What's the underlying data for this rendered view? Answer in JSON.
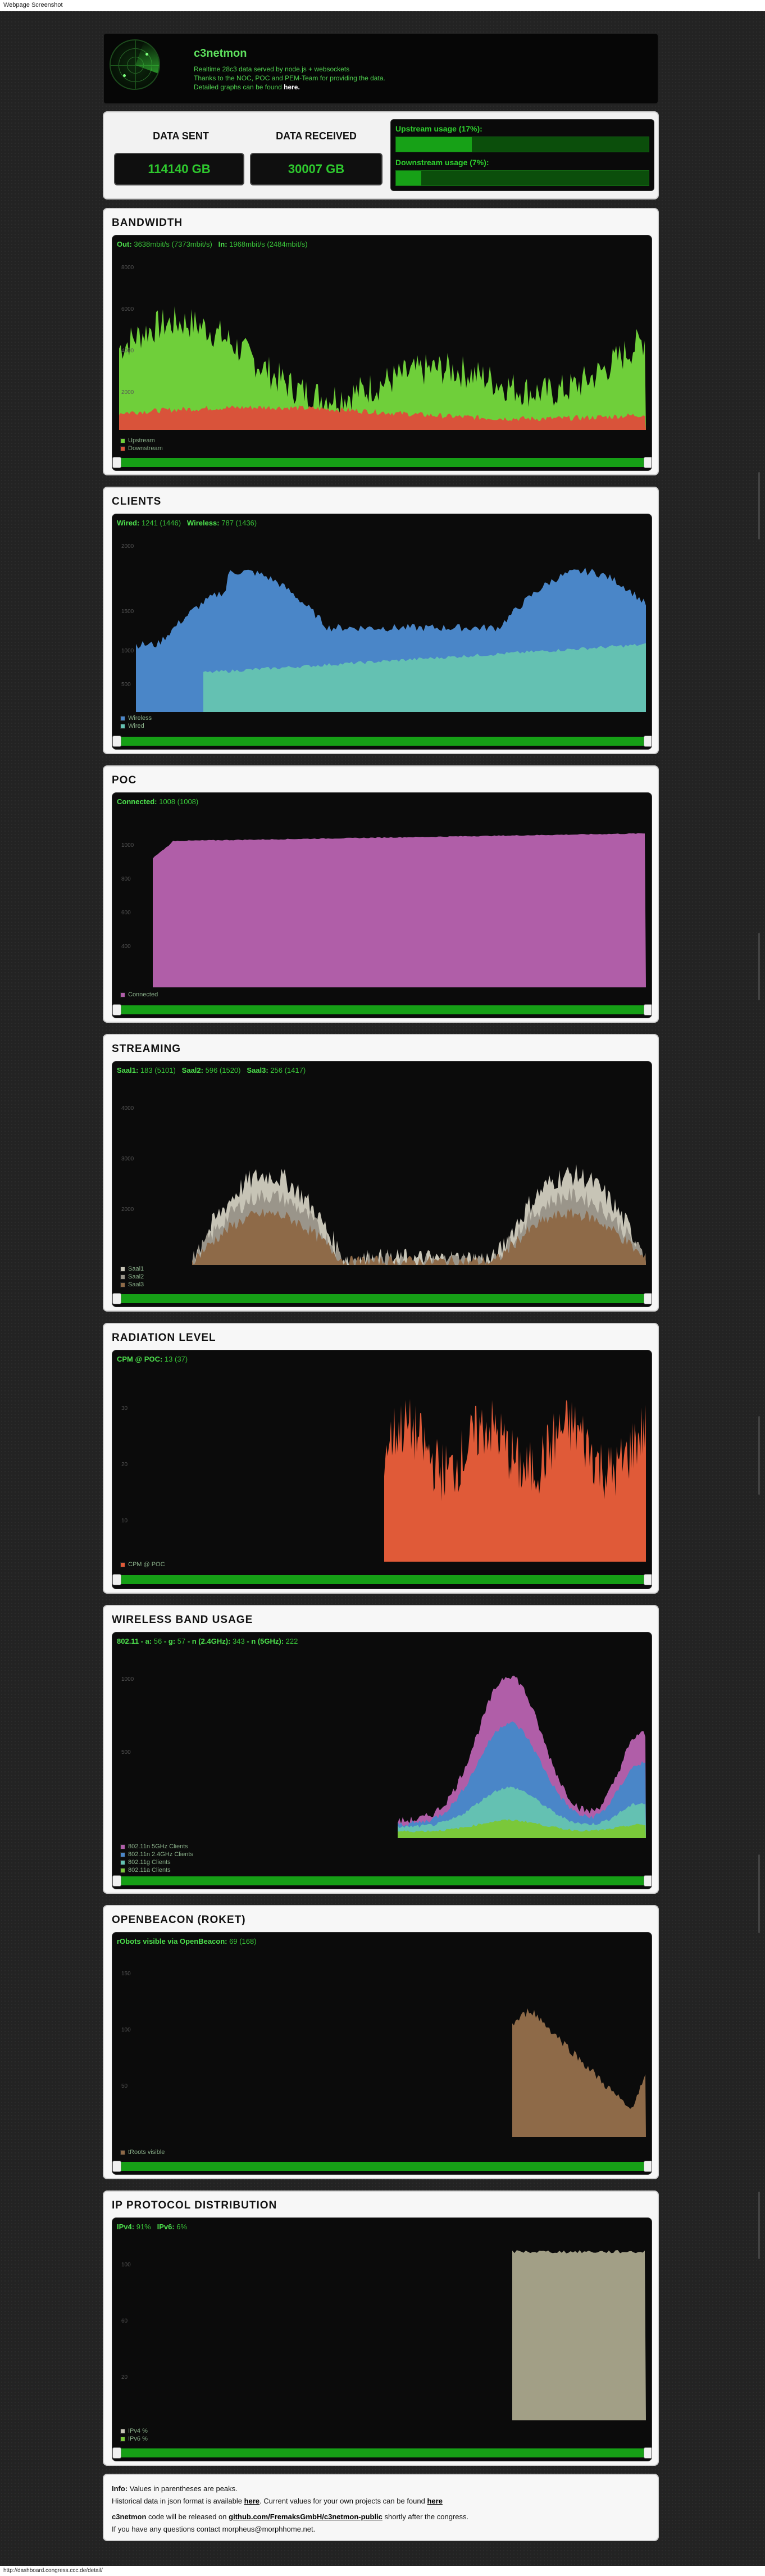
{
  "browser": {
    "top_title": "Webpage Screenshot",
    "status_url": "http://dashboard.congress.ccc.de/detail/"
  },
  "header": {
    "title": "c3netmon",
    "line1": "Realtime 28c3 data served by node.js + websockets",
    "line2": "Thanks to the NOC, POC and PEM-Team for providing the data.",
    "line3": "Detailed graphs can be found",
    "line3_link": "here."
  },
  "stats": {
    "sent_label": "DATA SENT",
    "sent_value": "114140 GB",
    "received_label": "DATA RECEIVED",
    "received_value": "30007 GB",
    "upstream_label": "Upstream usage (17%):",
    "upstream_pct": 0.3,
    "downstream_label": "Downstream usage (7%):",
    "downstream_pct": 0.1
  },
  "panels": {
    "bandwidth": {
      "title": "BANDWIDTH",
      "h1k": "Out:",
      "h1v": "3638mbit/s (7373mbit/s)",
      "h2k": "In:",
      "h2v": "1968mbit/s (2484mbit/s)",
      "legend": [
        "Upstream",
        "Downstream"
      ]
    },
    "clients": {
      "title": "CLIENTS",
      "h1k": "Wired:",
      "h1v": "1241 (1446)",
      "h2k": "Wireless:",
      "h2v": "787 (1436)",
      "legend": [
        "Wireless",
        "Wired"
      ]
    },
    "poc": {
      "title": "POC",
      "h1k": "Connected:",
      "h1v": "1008 (1008)",
      "legend": [
        "Connected"
      ]
    },
    "streaming": {
      "title": "STREAMING",
      "h1k": "Saal1:",
      "h1v": "183 (5101)",
      "h2k": "Saal2:",
      "h2v": "596 (1520)",
      "h3k": "Saal3:",
      "h3v": "256 (1417)",
      "legend": [
        "Saal1",
        "Saal2",
        "Saal3"
      ]
    },
    "radiation": {
      "title": "RADIATION LEVEL",
      "h1k": "CPM @ POC:",
      "h1v": "13 (37)",
      "legend": [
        "CPM @ POC"
      ]
    },
    "wireless": {
      "title": "WIRELESS BAND USAGE",
      "h1k": "802.11 - a:",
      "h1v": "56",
      "h2k": "- g:",
      "h2v": "57",
      "h3k": "- n (2.4GHz):",
      "h3v": "343",
      "h4k": "- n (5GHz):",
      "h4v": "222",
      "legend": [
        "802.11n 5GHz Clients",
        "802.11n 2.4GHz Clients",
        "802.11g Clients",
        "802.11a Clients"
      ]
    },
    "openbeacon": {
      "title": "OPENBEACON (ROKET)",
      "h1k": "rObots visible via OpenBeacon:",
      "h1v": "69 (168)",
      "legend": [
        "tRoots visible"
      ]
    },
    "ipproto": {
      "title": "IP PROTOCOL DISTRIBUTION",
      "h1k": "IPv4:",
      "h1v": "91%",
      "h2k": "IPv6:",
      "h2v": "6%",
      "legend": [
        "IPv4 %",
        "IPv6 %"
      ]
    }
  },
  "footer": {
    "info_k": "Info:",
    "info_v": "Values in parentheses are peaks.",
    "hist_a": "Historical data in json format is available",
    "hist_link": "here",
    "hist_b": ". Current values for your own projects can be found",
    "hist_link2": "here",
    "code_k": "c3netmon",
    "code_a": "code will be released on",
    "code_link": "github.com/FremaksGmbH/c3netmon-public",
    "code_b": "shortly after the congress.",
    "contact": "If you have any questions contact morpheus@morphhome.net."
  },
  "colors": {
    "green": "#6fcf3a",
    "red": "#d9533a",
    "blue": "#4a86c8",
    "teal": "#64c1b2",
    "pink": "#b05ea8",
    "bronze": "#8e6a48",
    "khaki": "#a29f86",
    "orange": "#e05a38"
  }
}
